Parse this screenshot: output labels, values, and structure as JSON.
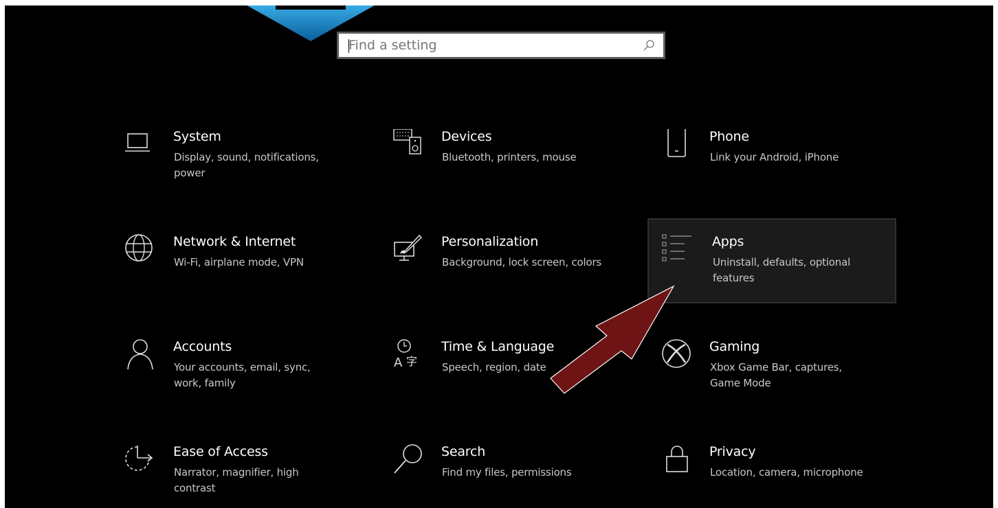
{
  "search": {
    "placeholder": "Find a setting"
  },
  "tiles": [
    {
      "title": "System",
      "desc": "Display, sound, notifications, power",
      "icon": "laptop-icon"
    },
    {
      "title": "Devices",
      "desc": "Bluetooth, printers, mouse",
      "icon": "devices-icon"
    },
    {
      "title": "Phone",
      "desc": "Link your Android, iPhone",
      "icon": "phone-icon"
    },
    {
      "title": "Network & Internet",
      "desc": "Wi-Fi, airplane mode, VPN",
      "icon": "globe-icon"
    },
    {
      "title": "Personalization",
      "desc": "Background, lock screen, colors",
      "icon": "paintbrush-icon"
    },
    {
      "title": "Apps",
      "desc": "Uninstall, defaults, optional features",
      "icon": "apps-list-icon"
    },
    {
      "title": "Accounts",
      "desc": "Your accounts, email, sync, work, family",
      "icon": "person-icon"
    },
    {
      "title": "Time & Language",
      "desc": "Speech, region, date",
      "icon": "time-language-icon"
    },
    {
      "title": "Gaming",
      "desc": "Xbox Game Bar, captures, Game Mode",
      "icon": "xbox-icon"
    },
    {
      "title": "Ease of Access",
      "desc": "Narrator, magnifier, high contrast",
      "icon": "ease-of-access-icon"
    },
    {
      "title": "Search",
      "desc": "Find my files, permissions",
      "icon": "search-icon"
    },
    {
      "title": "Privacy",
      "desc": "Location, camera, microphone",
      "icon": "lock-icon"
    }
  ],
  "colors": {
    "background": "#000000",
    "highlight_tile": "#1b1b1b",
    "pointer_arrow": "#6e1414",
    "top_arrow": "#1a8fd6"
  }
}
